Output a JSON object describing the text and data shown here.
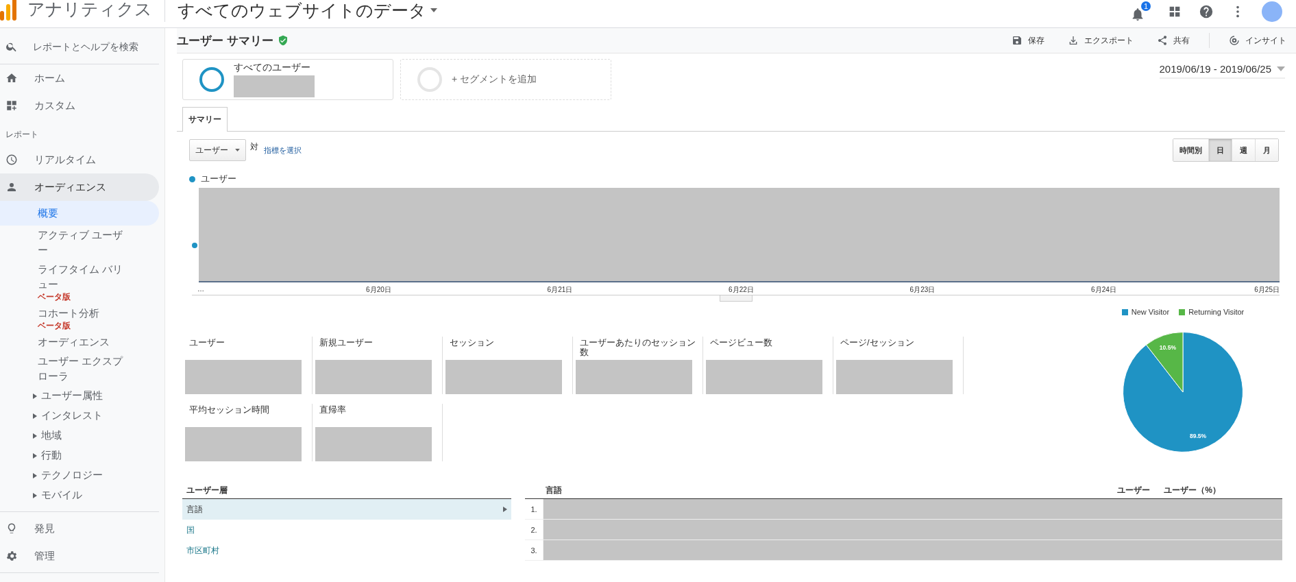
{
  "topbar": {
    "app_name": "アナリティクス",
    "property": "すべてのウェブサイトのデータ",
    "notification_count": "1"
  },
  "sidebar": {
    "search_placeholder": "レポートとヘルプを検索",
    "top_items": [
      {
        "label": "ホーム"
      },
      {
        "label": "カスタム"
      }
    ],
    "section_label": "レポート",
    "report_items": [
      {
        "label": "リアルタイム",
        "selected": false
      },
      {
        "label": "オーディエンス",
        "selected": true
      }
    ],
    "sub_items": [
      {
        "kind": "link",
        "label": "概要",
        "selected": true
      },
      {
        "kind": "link",
        "label": "アクティブ ユーザー",
        "selected": false
      },
      {
        "kind": "link",
        "label": "ライフタイム バリュー",
        "badge": "ベータ版",
        "selected": false
      },
      {
        "kind": "link",
        "label": "コホート分析",
        "badge": "ベータ版",
        "selected": false
      },
      {
        "kind": "link",
        "label": "オーディエンス",
        "selected": false
      },
      {
        "kind": "link",
        "label": "ユーザー エクスプローラ",
        "selected": false
      },
      {
        "kind": "group",
        "label": "ユーザー属性",
        "expanded": false
      },
      {
        "kind": "group",
        "label": "インタレスト",
        "expanded": false
      },
      {
        "kind": "group",
        "label": "地域",
        "expanded": false
      },
      {
        "kind": "group",
        "label": "行動",
        "expanded": false
      },
      {
        "kind": "group",
        "label": "テクノロジー",
        "expanded": false
      },
      {
        "kind": "group",
        "label": "モバイル",
        "expanded": false
      }
    ],
    "bottom_items": [
      {
        "label": "発見"
      },
      {
        "label": "管理"
      }
    ]
  },
  "report": {
    "title": "ユーザー サマリー",
    "actions": [
      {
        "label": "保存"
      },
      {
        "label": "エクスポート"
      },
      {
        "label": "共有"
      },
      {
        "label": "インサイト"
      }
    ],
    "segments": [
      {
        "kind": "segment",
        "label": "すべてのユーザー"
      },
      {
        "kind": "add",
        "label": "+ セグメントを追加"
      }
    ],
    "date_range": "2019/06/19 - 2019/06/25",
    "tabs": [
      {
        "label": "サマリー",
        "selected": true
      }
    ],
    "metric_dropdown": "ユーザー",
    "versus": "対",
    "select_metric": "指標を選択",
    "granularity": [
      {
        "label": "時間別",
        "selected": false
      },
      {
        "label": "日",
        "selected": true
      },
      {
        "label": "週",
        "selected": false
      },
      {
        "label": "月",
        "selected": false
      }
    ],
    "chart_legend": "ユーザー",
    "x_labels": [
      "…",
      "6月20日",
      "6月21日",
      "6月22日",
      "6月23日",
      "6月24日",
      "6月25日"
    ],
    "metrics": [
      {
        "label": "ユーザー"
      },
      {
        "label": "新規ユーザー"
      },
      {
        "label": "セッション"
      },
      {
        "label": "ユーザーあたりのセッション数"
      },
      {
        "label": "ページビュー数"
      },
      {
        "label": "ページ/セッション"
      },
      {
        "label": "平均セッション時間"
      },
      {
        "label": "直帰率"
      }
    ],
    "pie": {
      "chart_data": {
        "type": "pie",
        "categories": [
          "New Visitor",
          "Returning Visitor"
        ],
        "values": [
          89.5,
          10.5
        ],
        "colors": [
          "#1f93c4",
          "#57b747"
        ],
        "data_labels": true,
        "value_labels": [
          "89.5%",
          "10.5%"
        ]
      }
    },
    "demographics": {
      "title": "ユーザー層",
      "items": [
        {
          "label": "言語",
          "selected": true
        },
        {
          "label": "国",
          "selected": false
        },
        {
          "label": "市区町村",
          "selected": false
        }
      ]
    },
    "table": {
      "columns": [
        "言語",
        "ユーザー",
        "ユーザー（%）"
      ],
      "rows": [
        {
          "index": "1."
        },
        {
          "index": "2."
        },
        {
          "index": "3."
        }
      ]
    }
  }
}
